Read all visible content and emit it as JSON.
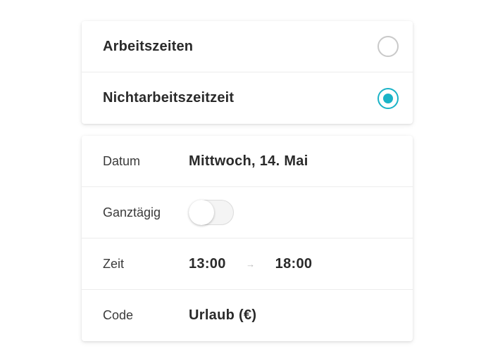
{
  "work_type": {
    "options": [
      {
        "label": "Arbeitszeiten",
        "selected": false
      },
      {
        "label": "Nichtarbeitszeitzeit",
        "selected": true
      }
    ]
  },
  "details": {
    "date": {
      "label": "Datum",
      "value": "Mittwoch, 14. Mai"
    },
    "all_day": {
      "label": "Ganztägig",
      "enabled": false
    },
    "time": {
      "label": "Zeit",
      "start": "13:00",
      "end": "18:00",
      "arrow": "→"
    },
    "code": {
      "label": "Code",
      "value": "Urlaub (€)"
    }
  },
  "colors": {
    "accent": "#1ab3c7",
    "radio_off": "#c9c9c9",
    "divider": "#ececec"
  }
}
